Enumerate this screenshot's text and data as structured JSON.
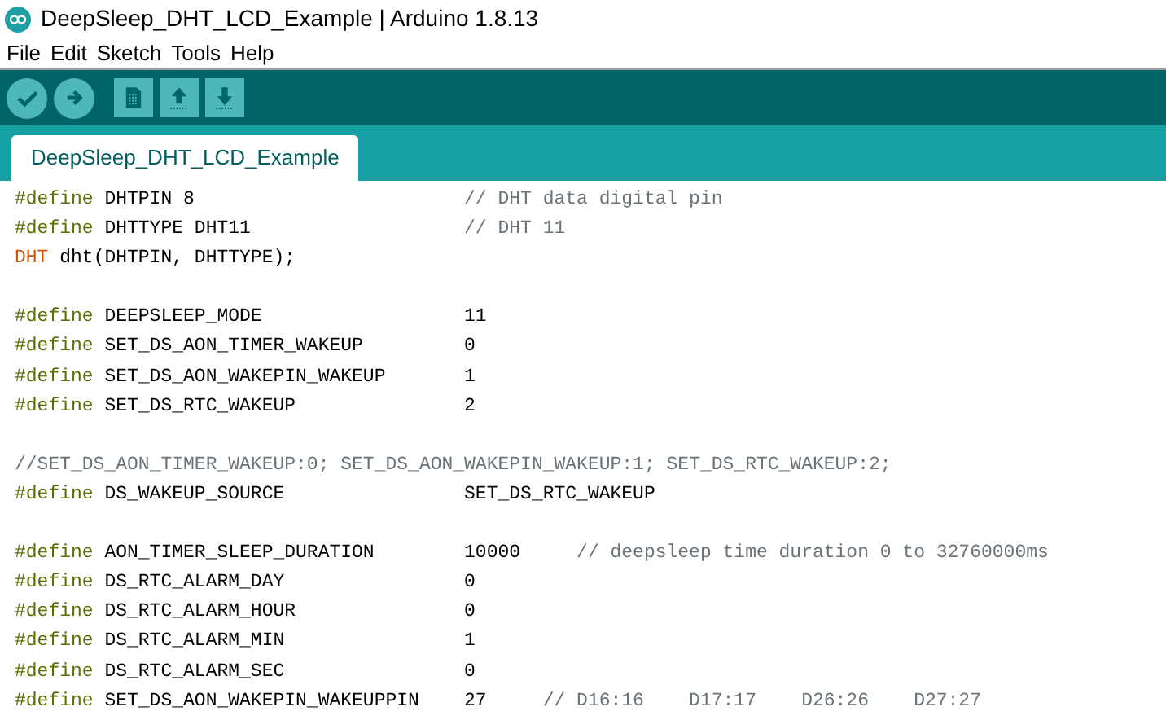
{
  "window": {
    "title": "DeepSleep_DHT_LCD_Example | Arduino 1.8.13"
  },
  "menu": [
    "File",
    "Edit",
    "Sketch",
    "Tools",
    "Help"
  ],
  "toolbar": [
    {
      "kind": "verify"
    },
    {
      "kind": "upload"
    },
    {
      "kind": "new"
    },
    {
      "kind": "open"
    },
    {
      "kind": "save"
    }
  ],
  "tabs": [
    {
      "label": "DeepSleep_DHT_LCD_Example",
      "selected": true
    }
  ],
  "code": [
    {
      "tokens": [
        {
          "kind": "directive",
          "text": "#define"
        },
        {
          "kind": "name",
          "text": "DHTPIN 8"
        },
        {
          "kind": "comment",
          "text": "// DHT data digital pin"
        }
      ]
    },
    {
      "tokens": [
        {
          "kind": "directive",
          "text": "#define"
        },
        {
          "kind": "name",
          "text": "DHTTYPE DHT11"
        },
        {
          "kind": "comment",
          "text": "// DHT 11"
        }
      ]
    },
    {
      "tokens": [
        {
          "kind": "type",
          "text": "DHT"
        },
        {
          "kind": "plain",
          "text": "dht(DHTPIN, DHTTYPE);"
        }
      ]
    },
    {
      "kind": "blank"
    },
    {
      "tokens": [
        {
          "kind": "directive",
          "text": "#define"
        },
        {
          "kind": "name",
          "text": "DEEPSLEEP_MODE"
        },
        {
          "kind": "value",
          "text": "11"
        }
      ]
    },
    {
      "tokens": [
        {
          "kind": "directive",
          "text": "#define"
        },
        {
          "kind": "name",
          "text": "SET_DS_AON_TIMER_WAKEUP"
        },
        {
          "kind": "value",
          "text": "0"
        }
      ]
    },
    {
      "tokens": [
        {
          "kind": "directive",
          "text": "#define"
        },
        {
          "kind": "name",
          "text": "SET_DS_AON_WAKEPIN_WAKEUP"
        },
        {
          "kind": "value",
          "text": "1"
        }
      ]
    },
    {
      "tokens": [
        {
          "kind": "directive",
          "text": "#define"
        },
        {
          "kind": "name",
          "text": "SET_DS_RTC_WAKEUP"
        },
        {
          "kind": "value",
          "text": "2"
        }
      ]
    },
    {
      "kind": "blank"
    },
    {
      "tokens": [
        {
          "kind": "comment",
          "text": "//SET_DS_AON_TIMER_WAKEUP:0; SET_DS_AON_WAKEPIN_WAKEUP:1; SET_DS_RTC_WAKEUP:2;"
        }
      ]
    },
    {
      "tokens": [
        {
          "kind": "directive",
          "text": "#define"
        },
        {
          "kind": "name",
          "text": "DS_WAKEUP_SOURCE"
        },
        {
          "kind": "value",
          "text": "SET_DS_RTC_WAKEUP"
        }
      ]
    },
    {
      "kind": "blank"
    },
    {
      "tokens": [
        {
          "kind": "directive",
          "text": "#define"
        },
        {
          "kind": "name",
          "text": "AON_TIMER_SLEEP_DURATION"
        },
        {
          "kind": "value",
          "text": "10000"
        },
        {
          "kind": "comment",
          "text": "// deepsleep time duration 0 to 32760000ms"
        }
      ]
    },
    {
      "tokens": [
        {
          "kind": "directive",
          "text": "#define"
        },
        {
          "kind": "name",
          "text": "DS_RTC_ALARM_DAY"
        },
        {
          "kind": "value",
          "text": "0"
        }
      ]
    },
    {
      "tokens": [
        {
          "kind": "directive",
          "text": "#define"
        },
        {
          "kind": "name",
          "text": "DS_RTC_ALARM_HOUR"
        },
        {
          "kind": "value",
          "text": "0"
        }
      ]
    },
    {
      "tokens": [
        {
          "kind": "directive",
          "text": "#define"
        },
        {
          "kind": "name",
          "text": "DS_RTC_ALARM_MIN"
        },
        {
          "kind": "value",
          "text": "1"
        }
      ]
    },
    {
      "tokens": [
        {
          "kind": "directive",
          "text": "#define"
        },
        {
          "kind": "name",
          "text": "DS_RTC_ALARM_SEC"
        },
        {
          "kind": "value",
          "text": "0"
        }
      ]
    },
    {
      "tokens": [
        {
          "kind": "directive",
          "text": "#define"
        },
        {
          "kind": "name",
          "text": "SET_DS_AON_WAKEPIN_WAKEUPPIN"
        },
        {
          "kind": "value",
          "text": "27"
        },
        {
          "kind": "comment",
          "text": "// D16:16    D17:17    D26:26    D27:27"
        }
      ]
    }
  ]
}
